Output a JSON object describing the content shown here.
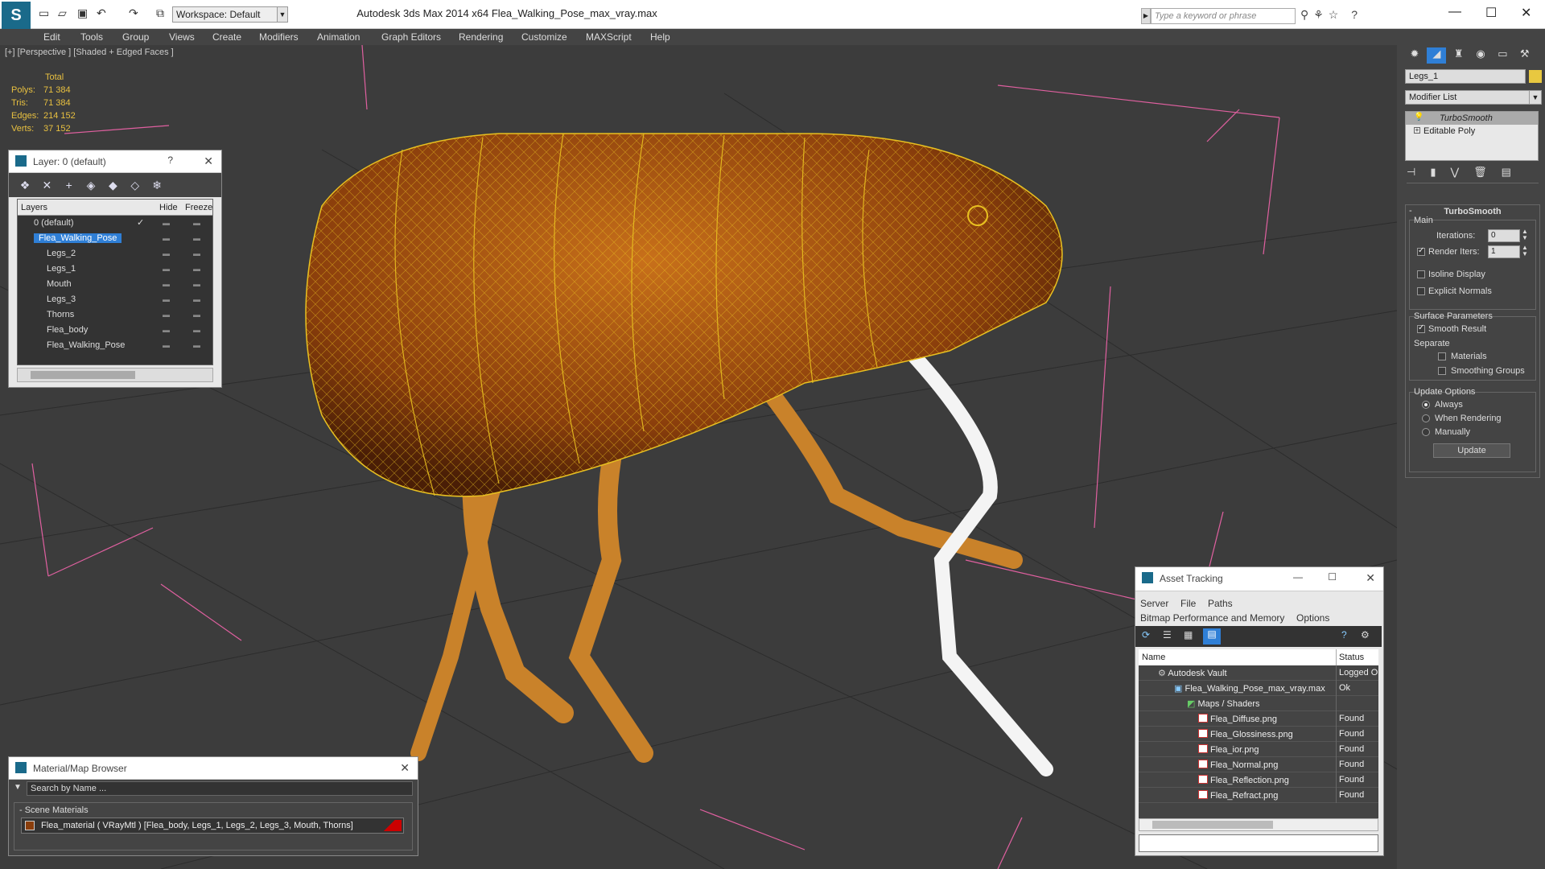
{
  "app": {
    "title": "Autodesk 3ds Max  2014 x64      Flea_Walking_Pose_max_vray.max",
    "workspace_label": "Workspace: Default",
    "search_placeholder": "Type a keyword or phrase"
  },
  "menu": [
    "Edit",
    "Tools",
    "Group",
    "Views",
    "Create",
    "Modifiers",
    "Animation",
    "Graph Editors",
    "Rendering",
    "Customize",
    "MAXScript",
    "Help"
  ],
  "viewport": {
    "label": "[+] [Perspective ] [Shaded + Edged Faces ]",
    "stats_header": "Total",
    "stats": [
      {
        "k": "Polys:",
        "v": "71 384"
      },
      {
        "k": "Tris:",
        "v": "71 384"
      },
      {
        "k": "Edges:",
        "v": "214 152"
      },
      {
        "k": "Verts:",
        "v": "37 152"
      }
    ]
  },
  "layer_panel": {
    "title": "Layer: 0 (default)",
    "help": "?",
    "col_layers": "Layers",
    "col_hide": "Hide",
    "col_freeze": "Freeze",
    "rows": [
      {
        "name": "0 (default)",
        "indent": 0,
        "selected": false
      },
      {
        "name": "Flea_Walking_Pose",
        "indent": 0,
        "selected": true
      },
      {
        "name": "Legs_2",
        "indent": 1,
        "selected": false
      },
      {
        "name": "Legs_1",
        "indent": 1,
        "selected": false
      },
      {
        "name": "Mouth",
        "indent": 1,
        "selected": false
      },
      {
        "name": "Legs_3",
        "indent": 1,
        "selected": false
      },
      {
        "name": "Thorns",
        "indent": 1,
        "selected": false
      },
      {
        "name": "Flea_body",
        "indent": 1,
        "selected": false
      },
      {
        "name": "Flea_Walking_Pose",
        "indent": 1,
        "selected": false
      }
    ]
  },
  "material_browser": {
    "title": "Material/Map Browser",
    "search_placeholder": "Search by Name ...",
    "section": "- Scene Materials",
    "material": "Flea_material  ( VRayMtl )  [Flea_body, Legs_1, Legs_2, Legs_3, Mouth, Thorns]"
  },
  "asset_tracking": {
    "title": "Asset Tracking",
    "menu1": [
      "Server",
      "File",
      "Paths"
    ],
    "menu2": [
      "Bitmap Performance and Memory",
      "Options"
    ],
    "col_name": "Name",
    "col_status": "Status",
    "rows": [
      {
        "name": "Autodesk Vault",
        "status": "Logged O",
        "indent": 24,
        "type": "vault"
      },
      {
        "name": "Flea_Walking_Pose_max_vray.max",
        "status": "Ok",
        "indent": 44,
        "type": "max"
      },
      {
        "name": "Maps / Shaders",
        "status": "",
        "indent": 60,
        "type": "folder"
      },
      {
        "name": "Flea_Diffuse.png",
        "status": "Found",
        "indent": 74,
        "type": "png"
      },
      {
        "name": "Flea_Glossiness.png",
        "status": "Found",
        "indent": 74,
        "type": "png"
      },
      {
        "name": "Flea_ior.png",
        "status": "Found",
        "indent": 74,
        "type": "png"
      },
      {
        "name": "Flea_Normal.png",
        "status": "Found",
        "indent": 74,
        "type": "png"
      },
      {
        "name": "Flea_Reflection.png",
        "status": "Found",
        "indent": 74,
        "type": "png"
      },
      {
        "name": "Flea_Refract.png",
        "status": "Found",
        "indent": 74,
        "type": "png"
      }
    ]
  },
  "command_panel": {
    "object_name": "Legs_1",
    "modifier_list": "Modifier List",
    "stack": [
      "TurboSmooth",
      "Editable Poly"
    ],
    "rollout_title": "TurboSmooth",
    "main_label": "Main",
    "iterations_label": "Iterations:",
    "iterations_value": "0",
    "render_iters_label": "Render Iters:",
    "render_iters_value": "1",
    "isoline": "Isoline Display",
    "explicit": "Explicit Normals",
    "surface_params": "Surface Parameters",
    "smooth_result": "Smooth Result",
    "separate": "Separate",
    "materials": "Materials",
    "smoothing_groups": "Smoothing Groups",
    "update_options": "Update Options",
    "always": "Always",
    "when_rendering": "When Rendering",
    "manually": "Manually",
    "update_btn": "Update"
  },
  "colors": {
    "accent": "#2f7fd6",
    "wire": "#e8c020",
    "flea": "#b05a10",
    "selection_box": "#e060a0"
  }
}
